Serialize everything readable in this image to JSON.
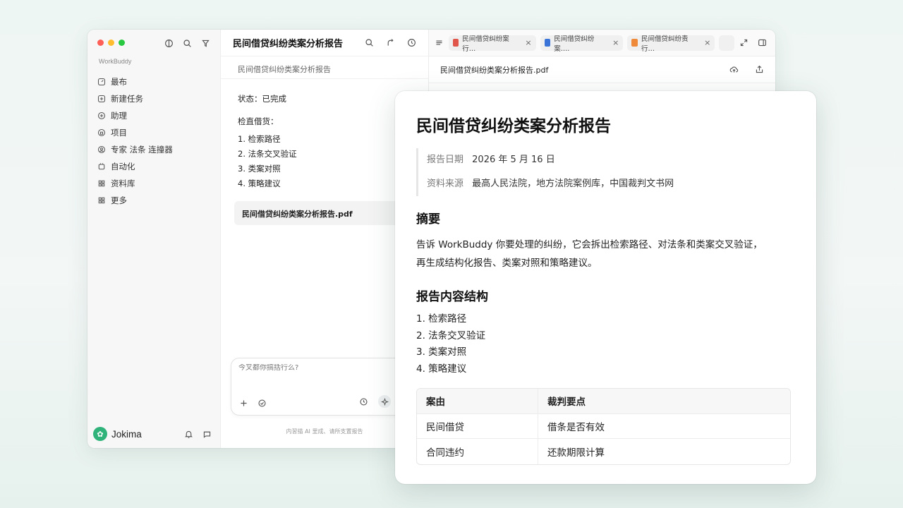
{
  "sidebar": {
    "brand_small": "WorkBuddy",
    "items": [
      {
        "label": "最布",
        "icon": "gauge-icon"
      },
      {
        "label": "新建任务",
        "icon": "plus-square-icon"
      },
      {
        "label": "助理",
        "icon": "assistant-icon"
      },
      {
        "label": "项目",
        "icon": "folder-icon"
      },
      {
        "label": "专家 法条 连撞器",
        "icon": "expert-icon"
      },
      {
        "label": "自动化",
        "icon": "automation-icon"
      },
      {
        "label": "资料库",
        "icon": "library-icon"
      },
      {
        "label": "更多",
        "icon": "more-icon"
      }
    ],
    "footer": {
      "brand": "Jokima",
      "logo_glyph": "✿"
    }
  },
  "middle": {
    "title": "民间借贷纠纷类案分析报告",
    "subtitle": "民间借贷纠纷类案分析报告",
    "status": "状态：已完成",
    "list_title": "检直借货：",
    "list": [
      "1.  检索路径",
      "2.  法条交叉验证",
      "3.  类案对照",
      "4.  策略建议"
    ],
    "file_name": "民间借贷纠纷类案分析报告.pdf",
    "composer_placeholder": "今叉都你搞括行么?",
    "footer": "内習描 AI 里成、请所支置报告"
  },
  "tabs": [
    {
      "label": "民间借贷纠纷案行…",
      "color": "#e0564a"
    },
    {
      "label": "民间借贷纠纷案….",
      "color": "#3b74d9"
    },
    {
      "label": "民间借贷纠纷责行…",
      "color": "#ef8a3b"
    }
  ],
  "file_header": {
    "name": "民间借贷纠纷类案分析报告.pdf"
  },
  "doc": {
    "title": "民间借贷纠纷类案分析报告",
    "date_label": "报告日期",
    "date_value": "2026 年 5 月 16 日",
    "source_label": "资料来源",
    "source_value": "最高人民法院，地方法院案例库，中国裁判文书网",
    "summary_heading": "摘要",
    "summary_line1": "告诉 WorkBuddy 你要处理的纠纷，它会拆出检索路径、对法条和类案交叉验证，",
    "summary_line2": "再生成结构化报告、类案对照和策略建议。",
    "structure_heading": "报告内容结构",
    "structure_list": [
      "1.  检索路径",
      "2.  法条交叉验证",
      "3.  类案对照",
      "4.  策略建议"
    ],
    "table": {
      "headers": [
        "案由",
        "裁判要点"
      ],
      "rows": [
        [
          "民间借贷",
          "借条是否有效"
        ],
        [
          "合同违约",
          "还款期限计算"
        ]
      ]
    }
  }
}
